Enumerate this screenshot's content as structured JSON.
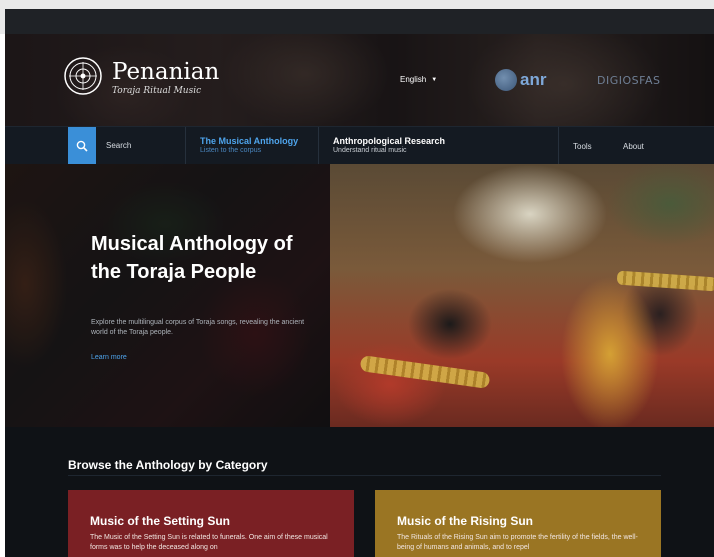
{
  "header": {
    "brand_name": "Penanian",
    "brand_tagline": "Toraja Ritual Music",
    "language": "English",
    "partner_logo_1": "anr",
    "partner_logo_2": "DIGIOSFAS"
  },
  "nav": {
    "search_label": "Search",
    "items": [
      {
        "title": "The Musical Anthology",
        "subtitle": "Listen to the corpus"
      },
      {
        "title": "Anthropological Research",
        "subtitle": "Understand ritual music"
      }
    ],
    "links": [
      "Tools",
      "About"
    ]
  },
  "hero": {
    "title": "Musical Anthology of the Toraja People",
    "description": "Explore the multilingual corpus of Toraja songs, revealing the ancient world of the Toraja people.",
    "link": "Learn more"
  },
  "browse": {
    "heading": "Browse the Anthology by Category",
    "cards": [
      {
        "title": "Music of the Setting Sun",
        "text": "The Music of the Setting Sun is related to funerals. One aim of these musical forms was to help the deceased along on"
      },
      {
        "title": "Music of the Rising Sun",
        "text": "The Rituals of the Rising Sun aim to promote the fertility of the fields, the well-being of humans and animals, and to repel"
      }
    ]
  },
  "colors": {
    "accent": "#3a8fd8",
    "setting_sun_card": "#7a2024",
    "rising_sun_card": "#9a7523",
    "background": "#0f1216"
  }
}
